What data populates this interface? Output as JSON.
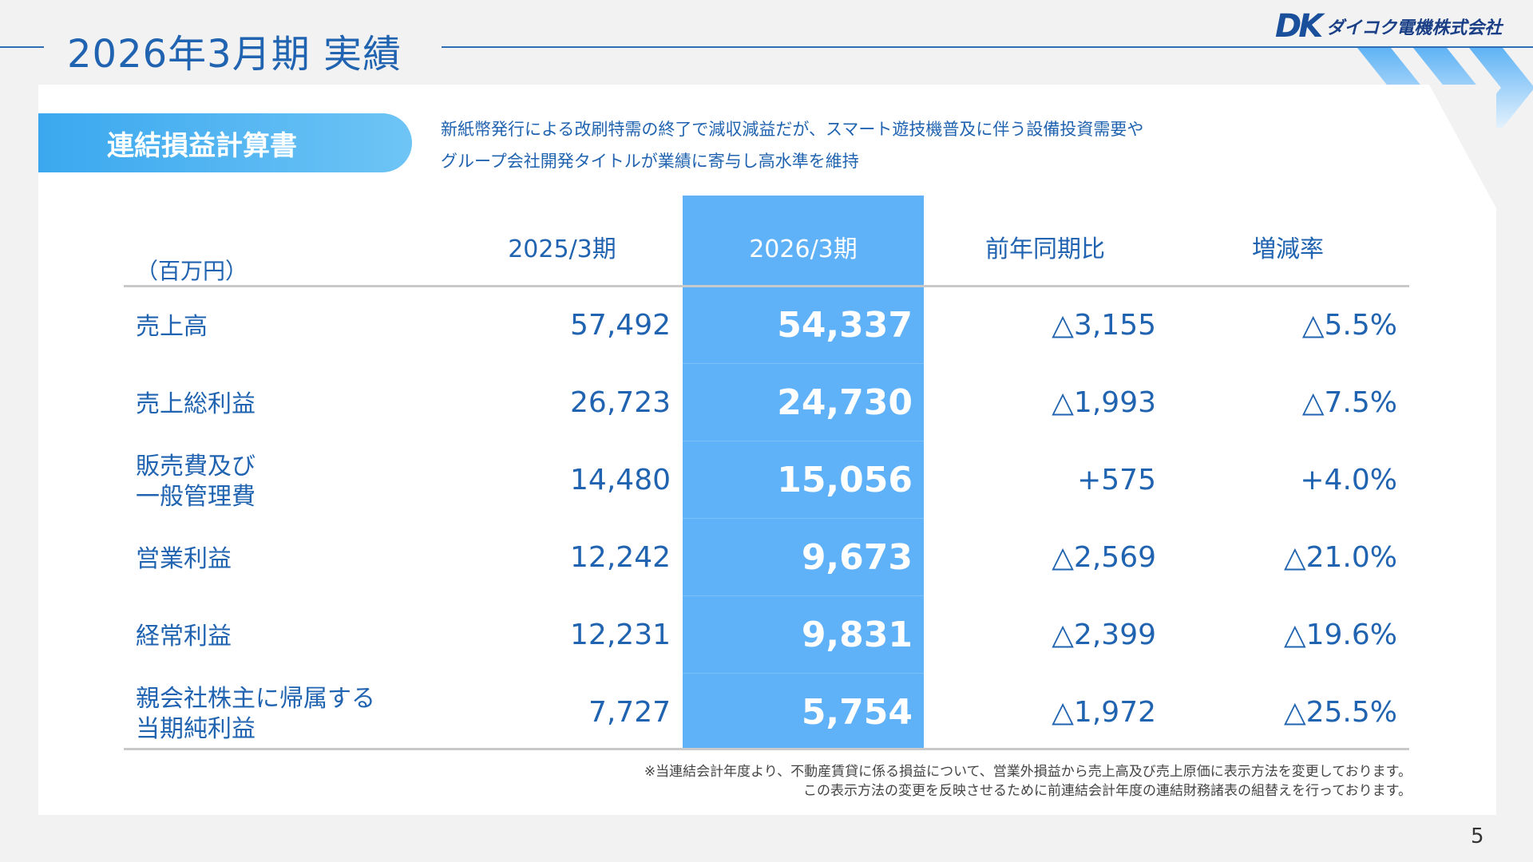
{
  "page": {
    "title": "2026年3月期 実績",
    "number": "5"
  },
  "logo": {
    "mark_d": "D",
    "mark_k": "K",
    "company": "ダイコク電機株式会社"
  },
  "section": {
    "label": "連結損益計算書",
    "description": [
      "新紙幣発行による改刷特需の終了で減収減益だが、スマート遊技機普及に伴う設備投資需要や",
      "グループ会社開発タイトルが業績に寄与し高水準を維持"
    ]
  },
  "table": {
    "unit": "（百万円）",
    "headers": [
      "2025/3期",
      "2026/3期",
      "前年同期比",
      "増減率"
    ],
    "rows": [
      {
        "label": [
          "売上高"
        ],
        "prev": "57,492",
        "curr": "54,337",
        "diff": "△3,155",
        "rate": "△5.5%"
      },
      {
        "label": [
          "売上総利益"
        ],
        "prev": "26,723",
        "curr": "24,730",
        "diff": "△1,993",
        "rate": "△7.5%"
      },
      {
        "label": [
          "販売費及び",
          "一般管理費"
        ],
        "prev": "14,480",
        "curr": "15,056",
        "diff": "+575",
        "rate": "+4.0%"
      },
      {
        "label": [
          "営業利益"
        ],
        "prev": "12,242",
        "curr": "9,673",
        "diff": "△2,569",
        "rate": "△21.0%"
      },
      {
        "label": [
          "経常利益"
        ],
        "prev": "12,231",
        "curr": "9,831",
        "diff": "△2,399",
        "rate": "△19.6%"
      },
      {
        "label": [
          "親会社株主に帰属する",
          "当期純利益"
        ],
        "prev": "7,727",
        "curr": "5,754",
        "diff": "△1,972",
        "rate": "△25.5%"
      }
    ]
  },
  "notes": [
    "※当連結会計年度より、不動産賃貸に係る損益について、営業外損益から売上高及び売上原価に表示方法を変更しております。",
    "この表示方法の変更を反映させるために前連結会計年度の連結財務諸表の組替えを行っております。"
  ],
  "colors": {
    "accent": "#2063b0",
    "highlight": "#5fb1f8",
    "label_gradient_start": "#3aa8ef",
    "label_gradient_end": "#6ec4f5"
  }
}
